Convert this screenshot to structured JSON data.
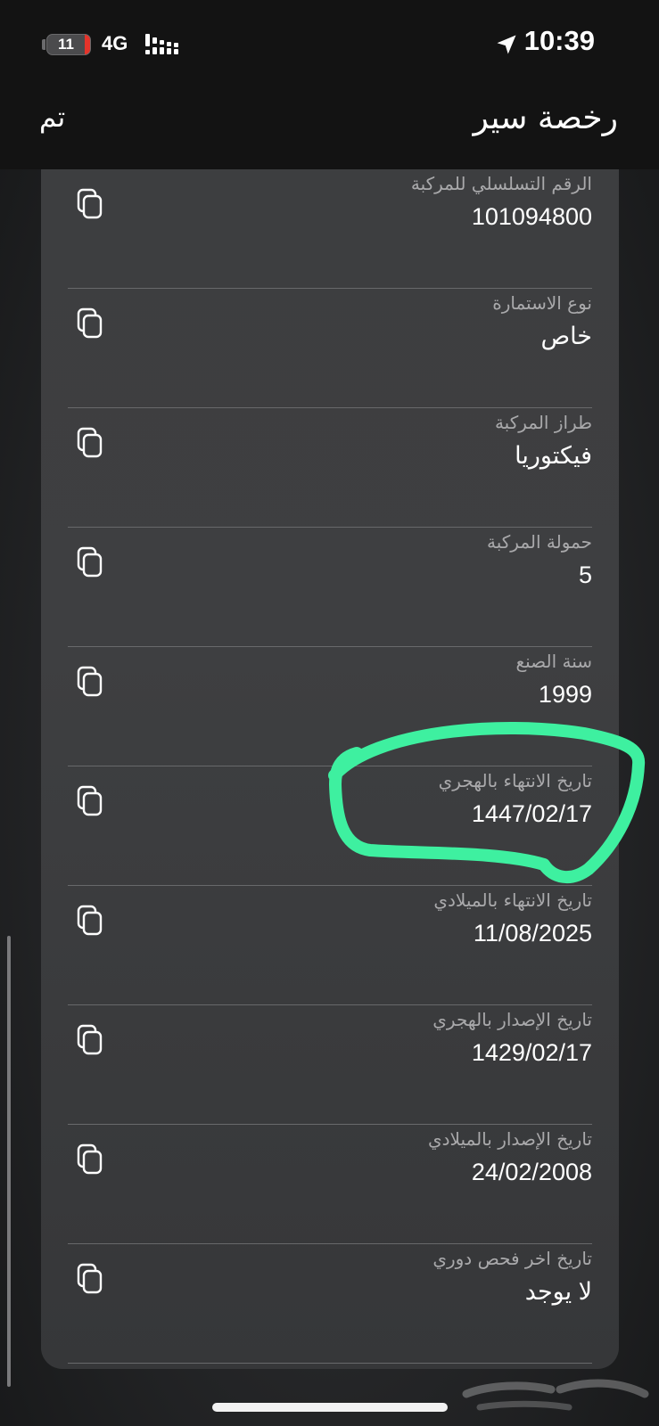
{
  "status_bar": {
    "battery": "11",
    "network": "4G",
    "time": "10:39"
  },
  "nav": {
    "done_label": "تم",
    "title": "رخصة سير"
  },
  "fields": [
    {
      "label": "الرقم التسلسلي للمركبة",
      "value": "101094800"
    },
    {
      "label": "نوع الاستمارة",
      "value": "خاص"
    },
    {
      "label": "طراز المركبة",
      "value": "فيكتوريا"
    },
    {
      "label": "حمولة المركبة",
      "value": "5"
    },
    {
      "label": "سنة الصنع",
      "value": "1999"
    },
    {
      "label": "تاريخ الانتهاء بالهجري",
      "value": "1447/02/17",
      "highlighted": true
    },
    {
      "label": "تاريخ الانتهاء بالميلادي",
      "value": "11/08/2025"
    },
    {
      "label": "تاريخ الإصدار بالهجري",
      "value": "1429/02/17"
    },
    {
      "label": "تاريخ الإصدار بالميلادي",
      "value": "24/02/2008"
    },
    {
      "label": "تاريخ اخر فحص دوري",
      "value": "لا يوجد"
    }
  ],
  "icons": {
    "copy": "copy-icon",
    "location": "location-arrow-icon"
  },
  "colors": {
    "highlight": "#3ef0a0",
    "background": "#2a2b2d",
    "card": "#3d3e40"
  }
}
